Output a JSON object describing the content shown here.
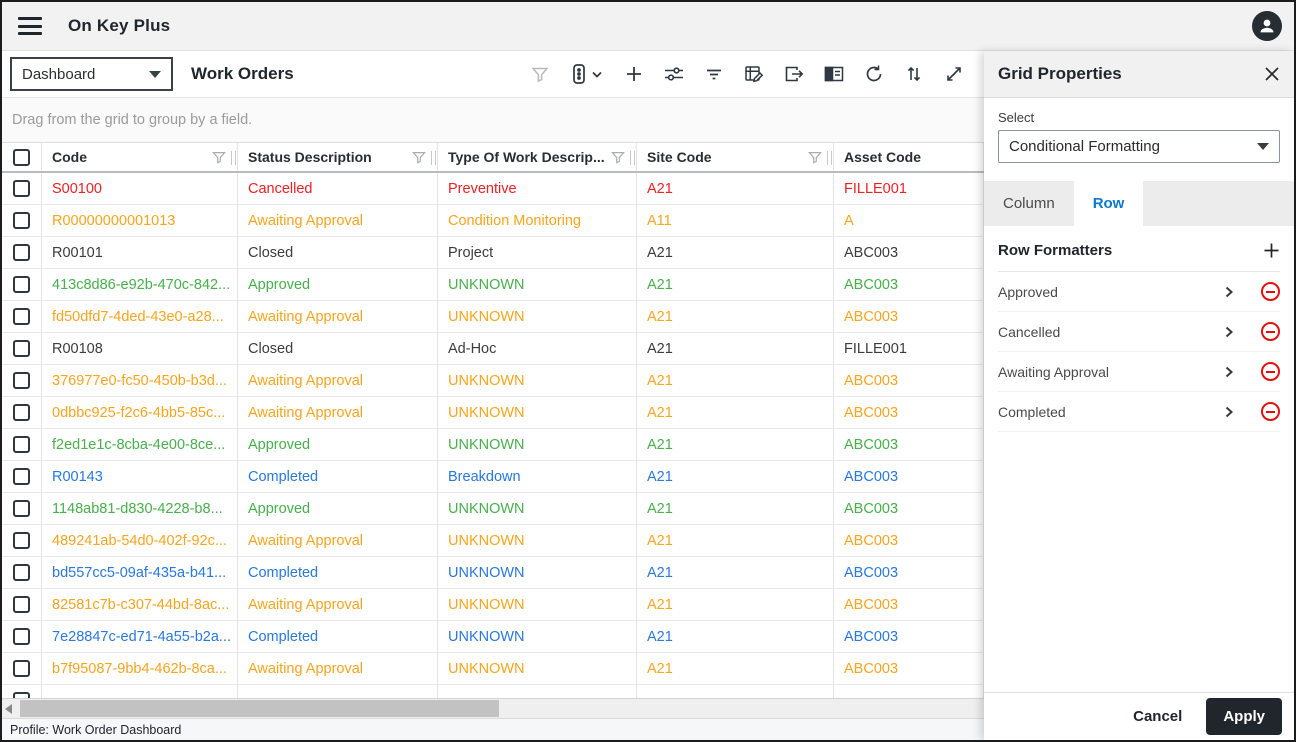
{
  "app": {
    "title": "On Key Plus"
  },
  "topbar_icons": [
    "menu-icon",
    "user-avatar-icon"
  ],
  "toolbar": {
    "profile_select_value": "Dashboard",
    "view_title": "Work Orders",
    "icons": [
      "filter-icon",
      "columns-menu-icon",
      "add-icon",
      "adjustments-icon",
      "filter-rows-icon",
      "edit-grid-icon",
      "export-icon",
      "side-panel-icon",
      "refresh-icon",
      "sort-icon",
      "expand-icon"
    ]
  },
  "groupbar": {
    "hint": "Drag from the grid to group by a field."
  },
  "grid": {
    "columns": [
      {
        "label": "Code",
        "filter": true
      },
      {
        "label": "Status Description",
        "filter": true
      },
      {
        "label": "Type Of Work Descrip...",
        "filter": true
      },
      {
        "label": "Site Code",
        "filter": true
      },
      {
        "label": "Asset Code",
        "filter": false
      }
    ],
    "rows": [
      {
        "code": "S00100",
        "status": "Cancelled",
        "type": "Preventive",
        "site": "A21",
        "asset": "FILLE001",
        "color": "red"
      },
      {
        "code": "R00000000001013",
        "status": "Awaiting Approval",
        "type": "Condition Monitoring",
        "site": "A11",
        "asset": "A",
        "color": "orange"
      },
      {
        "code": "R00101",
        "status": "Closed",
        "type": "Project",
        "site": "A21",
        "asset": "ABC003",
        "color": "default"
      },
      {
        "code": "413c8d86-e92b-470c-842...",
        "status": "Approved",
        "type": "UNKNOWN",
        "site": "A21",
        "asset": "ABC003",
        "color": "green"
      },
      {
        "code": "fd50dfd7-4ded-43e0-a28...",
        "status": "Awaiting Approval",
        "type": "UNKNOWN",
        "site": "A21",
        "asset": "ABC003",
        "color": "orange"
      },
      {
        "code": "R00108",
        "status": "Closed",
        "type": "Ad-Hoc",
        "site": "A21",
        "asset": "FILLE001",
        "color": "default"
      },
      {
        "code": "376977e0-fc50-450b-b3d...",
        "status": "Awaiting Approval",
        "type": "UNKNOWN",
        "site": "A21",
        "asset": "ABC003",
        "color": "orange"
      },
      {
        "code": "0dbbc925-f2c6-4bb5-85c...",
        "status": "Awaiting Approval",
        "type": "UNKNOWN",
        "site": "A21",
        "asset": "ABC003",
        "color": "orange"
      },
      {
        "code": "f2ed1e1c-8cba-4e00-8ce...",
        "status": "Approved",
        "type": "UNKNOWN",
        "site": "A21",
        "asset": "ABC003",
        "color": "green"
      },
      {
        "code": "R00143",
        "status": "Completed",
        "type": "Breakdown",
        "site": "A21",
        "asset": "ABC003",
        "color": "blue"
      },
      {
        "code": "1148ab81-d830-4228-b8...",
        "status": "Approved",
        "type": "UNKNOWN",
        "site": "A21",
        "asset": "ABC003",
        "color": "green"
      },
      {
        "code": "489241ab-54d0-402f-92c...",
        "status": "Awaiting Approval",
        "type": "UNKNOWN",
        "site": "A21",
        "asset": "ABC003",
        "color": "orange"
      },
      {
        "code": "bd557cc5-09af-435a-b41...",
        "status": "Completed",
        "type": "UNKNOWN",
        "site": "A21",
        "asset": "ABC003",
        "color": "blue"
      },
      {
        "code": "82581c7b-c307-44bd-8ac...",
        "status": "Awaiting Approval",
        "type": "UNKNOWN",
        "site": "A21",
        "asset": "ABC003",
        "color": "orange"
      },
      {
        "code": "7e28847c-ed71-4a55-b2a...",
        "status": "Completed",
        "type": "UNKNOWN",
        "site": "A21",
        "asset": "ABC003",
        "color": "blue"
      },
      {
        "code": "b7f95087-9bb4-462b-8ca...",
        "status": "Awaiting Approval",
        "type": "UNKNOWN",
        "site": "A21",
        "asset": "ABC003",
        "color": "orange"
      }
    ]
  },
  "panel": {
    "title": "Grid Properties",
    "close_icon": "close-icon",
    "select_label": "Select",
    "select_value": "Conditional Formatting",
    "tabs": [
      {
        "label": "Column",
        "active": false
      },
      {
        "label": "Row",
        "active": true
      }
    ],
    "section_title": "Row Formatters",
    "add_icon": "plus-icon",
    "formatters": [
      "Approved",
      "Cancelled",
      "Awaiting Approval",
      "Completed"
    ],
    "cancel_label": "Cancel",
    "apply_label": "Apply"
  },
  "statusbar": {
    "text": "Profile: Work Order Dashboard"
  },
  "colors": {
    "red": "#ed2024",
    "orange": "#f7a41d",
    "green": "#47b04b",
    "blue": "#2878dd",
    "default": "#3c3c3c",
    "accent_blue": "#0b79d0",
    "dark": "#20262c"
  }
}
